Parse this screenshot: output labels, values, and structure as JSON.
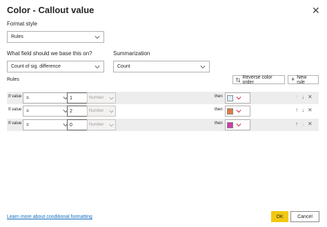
{
  "dialog": {
    "title": "Color - Callout value",
    "close_glyph": "✕"
  },
  "format_style": {
    "label": "Format style",
    "value": "Rules"
  },
  "field": {
    "label": "What field should we base this on?",
    "value": "Count of sig. difference"
  },
  "summarization": {
    "label": "Summarization",
    "value": "Count"
  },
  "rules": {
    "label": "Rules",
    "reverse_label": "Reverse color order",
    "new_rule_label": "New rule",
    "rows": [
      {
        "if_label": "If value",
        "operator": "=",
        "value": "1",
        "type": "Number",
        "then_label": "then",
        "color": "#dceefb",
        "color_name": "light-blue"
      },
      {
        "if_label": "If value",
        "operator": "=",
        "value": "2",
        "type": "Number",
        "then_label": "then",
        "color": "#e07a45",
        "color_name": "orange"
      },
      {
        "if_label": "If value",
        "operator": "=",
        "value": "0",
        "type": "Number",
        "then_label": "then",
        "color": "#cc3da8",
        "color_name": "magenta"
      }
    ]
  },
  "footer": {
    "learn_more": "Learn more about conditional formatting",
    "ok_label": "OK",
    "cancel_label": "Cancel"
  },
  "colors": {
    "accent_ok": "#f2c811",
    "link": "#0f6cbd",
    "row_bg": "#ededed"
  },
  "icons": [
    "close-icon",
    "chevron-down-icon",
    "reverse-order-icon",
    "plus-icon",
    "arrow-up-icon",
    "arrow-down-icon",
    "delete-icon"
  ]
}
